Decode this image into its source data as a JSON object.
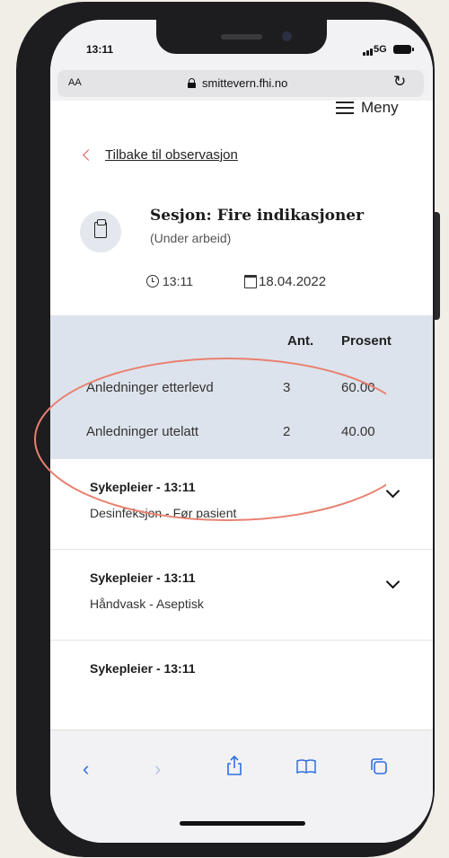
{
  "status_bar": {
    "time": "13:11",
    "network": "5G"
  },
  "browser": {
    "text_size_label": "AA",
    "url": "smittevern.fhi.no"
  },
  "header": {
    "menu_label": "Meny"
  },
  "back_link": {
    "label": "Tilbake til observasjon"
  },
  "session": {
    "title": "Sesjon: Fire indikasjoner",
    "status": "(Under arbeid)",
    "time": "13:11",
    "date": "18.04.2022"
  },
  "stats": {
    "headers": {
      "count": "Ant.",
      "percent": "Prosent"
    },
    "rows": [
      {
        "label": "Anledninger etterlevd",
        "count": "3",
        "percent": "60.00"
      },
      {
        "label": "Anledninger utelatt",
        "count": "2",
        "percent": "40.00"
      }
    ],
    "highlight_color": "#e8806f"
  },
  "observations": [
    {
      "title": "Sykepleier - 13:11",
      "subtitle": "Desinfeksjon - Før pasient"
    },
    {
      "title": "Sykepleier - 13:11",
      "subtitle": "Håndvask - Aseptisk"
    },
    {
      "title": "Sykepleier - 13:11",
      "subtitle": ""
    }
  ],
  "toolbar": {
    "back_icon": "chevron-left-icon",
    "forward_icon": "chevron-right-icon",
    "share_icon": "share-icon",
    "bookmarks_icon": "book-icon",
    "tabs_icon": "tabs-icon"
  },
  "colors": {
    "accent": "#e05a4e",
    "stats_bg": "#dde3ec",
    "ios_blue": "#2f6fe0"
  }
}
